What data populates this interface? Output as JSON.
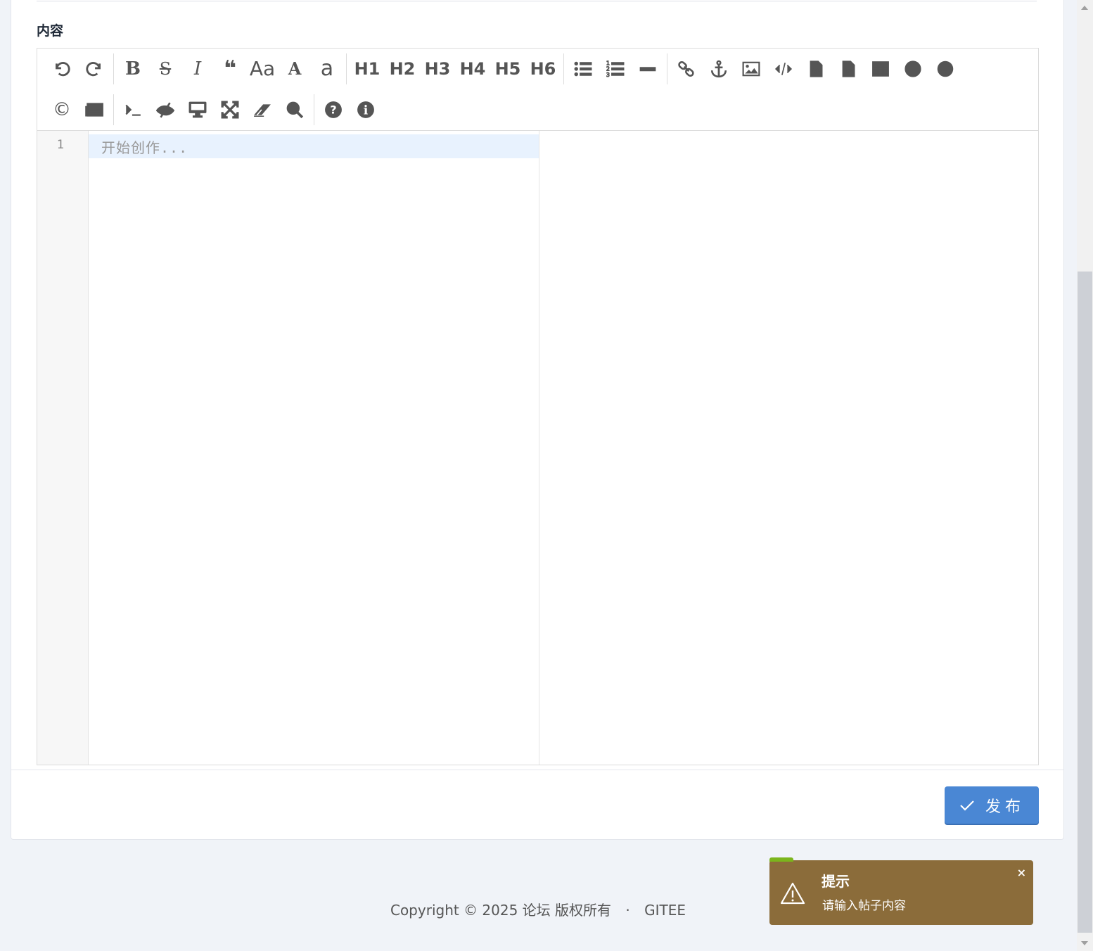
{
  "form": {
    "content_label": "内容"
  },
  "editor": {
    "toolbar_row1": [
      {
        "name": "undo-icon",
        "glyph": "undo"
      },
      {
        "name": "redo-icon",
        "glyph": "redo"
      },
      {
        "sep": true
      },
      {
        "name": "bold-icon",
        "label": "B"
      },
      {
        "name": "strikethrough-icon",
        "label": "S"
      },
      {
        "name": "italic-icon",
        "label": "I"
      },
      {
        "name": "quote-icon",
        "label": "❝"
      },
      {
        "name": "uppercase-icon",
        "label": "Aa"
      },
      {
        "name": "font-uppercase-icon",
        "label": "A"
      },
      {
        "name": "font-lowercase-icon",
        "label": "a"
      },
      {
        "sep": true
      },
      {
        "name": "h1-button",
        "label": "H1"
      },
      {
        "name": "h2-button",
        "label": "H2"
      },
      {
        "name": "h3-button",
        "label": "H3"
      },
      {
        "name": "h4-button",
        "label": "H4"
      },
      {
        "name": "h5-button",
        "label": "H5"
      },
      {
        "name": "h6-button",
        "label": "H6"
      },
      {
        "sep": true
      },
      {
        "name": "unordered-list-icon",
        "glyph": "ul"
      },
      {
        "name": "ordered-list-icon",
        "glyph": "ol"
      },
      {
        "name": "horizontal-rule-icon",
        "glyph": "hr"
      },
      {
        "sep": true
      },
      {
        "name": "link-icon",
        "glyph": "link"
      },
      {
        "name": "anchor-icon",
        "glyph": "anchor"
      },
      {
        "name": "image-icon",
        "glyph": "image"
      },
      {
        "name": "inline-code-icon",
        "glyph": "code"
      },
      {
        "name": "code-block-icon",
        "glyph": "file-code"
      },
      {
        "name": "preformatted-text-icon",
        "glyph": "file-code"
      },
      {
        "name": "table-icon",
        "glyph": "table"
      },
      {
        "name": "datetime-icon",
        "glyph": "clock"
      },
      {
        "name": "emoji-icon",
        "glyph": "smile"
      }
    ],
    "toolbar_row2": [
      {
        "name": "html-entities-icon",
        "label": "©"
      },
      {
        "name": "pagebreak-icon",
        "glyph": "newspaper"
      },
      {
        "sep": true
      },
      {
        "name": "goto-line-icon",
        "glyph": "terminal"
      },
      {
        "name": "toggle-preview-icon",
        "glyph": "eye-slash"
      },
      {
        "name": "html-preview-icon",
        "glyph": "desktop"
      },
      {
        "name": "fullscreen-icon",
        "glyph": "expand"
      },
      {
        "name": "clear-icon",
        "glyph": "eraser"
      },
      {
        "name": "search-icon",
        "glyph": "search"
      },
      {
        "sep": true
      },
      {
        "name": "help-icon",
        "glyph": "question"
      },
      {
        "name": "info-icon",
        "glyph": "info"
      }
    ],
    "line_number": "1",
    "placeholder": "开始创作..."
  },
  "actions": {
    "publish_label": "发布"
  },
  "footer": {
    "copyright": "Copyright © 2025 论坛 版权所有",
    "separator": "·",
    "gitee_link": "GITEE"
  },
  "toast": {
    "title": "提示",
    "message": "请输入帖子内容",
    "close": "×",
    "bg_color": "#8b6c3a",
    "accent_color": "#7bb51c"
  },
  "colors": {
    "primary": "#4a87d4",
    "page_bg": "#f0f3f8"
  }
}
